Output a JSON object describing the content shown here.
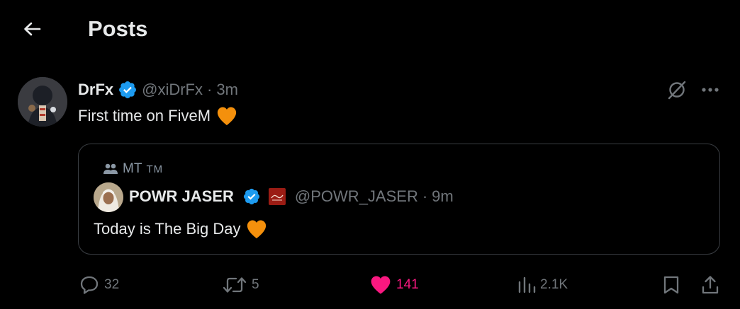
{
  "header": {
    "title": "Posts",
    "back_icon": "arrow-left-icon"
  },
  "post": {
    "display_name": "DrFx",
    "handle": "@xiDrFx",
    "separator": "·",
    "time": "3m",
    "text": "First time on FiveM",
    "emoji": "orange-heart-icon"
  },
  "quote": {
    "community": "MT",
    "community_sub": "TM",
    "display_name": "POWR JASER",
    "handle": "@POWR_JASER",
    "separator": "·",
    "time": "9m",
    "text": "Today is The Big Day",
    "emoji": "orange-heart-icon"
  },
  "actions": {
    "replies": "32",
    "reposts": "5",
    "likes": "141",
    "views": "2.1K"
  },
  "colors": {
    "background": "#000000",
    "text": "#e7e9ea",
    "muted": "#71767b",
    "verified": "#1d9bf0",
    "like": "#f91880",
    "heart_emoji": "#f4900c",
    "border": "#3a3e43"
  }
}
